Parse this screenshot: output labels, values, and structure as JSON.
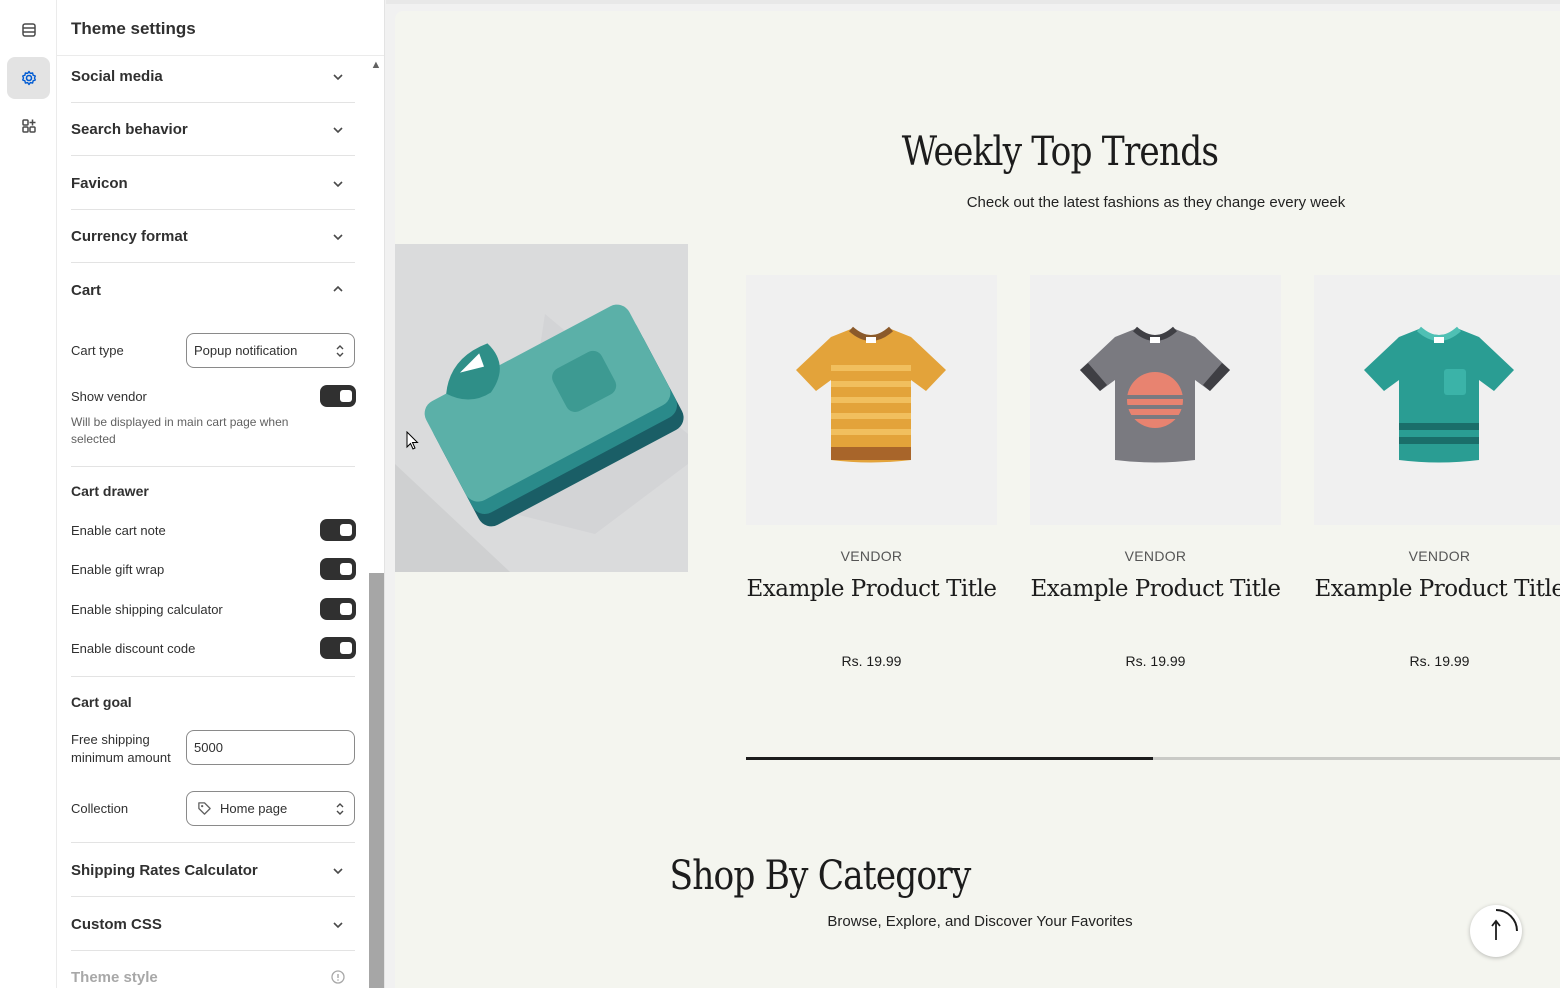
{
  "rail": {
    "items": [
      {
        "name": "sections-icon",
        "active": false
      },
      {
        "name": "settings-gear-icon",
        "active": true
      },
      {
        "name": "apps-icon",
        "active": false
      }
    ]
  },
  "panel": {
    "title": "Theme settings",
    "sections": {
      "social_media": "Social media",
      "search_behavior": "Search behavior",
      "favicon": "Favicon",
      "currency_format": "Currency format",
      "cart": "Cart",
      "shipping_rates": "Shipping Rates Calculator",
      "custom_css": "Custom CSS",
      "theme_style": "Theme style"
    },
    "cart": {
      "cart_type_label": "Cart type",
      "cart_type_value": "Popup notification",
      "show_vendor_label": "Show vendor",
      "show_vendor_on": true,
      "show_vendor_help": "Will be displayed in main cart page when selected",
      "drawer_heading": "Cart drawer",
      "enable_cart_note": "Enable cart note",
      "enable_gift_wrap": "Enable gift wrap",
      "enable_shipping_calculator": "Enable shipping calculator",
      "enable_discount_code": "Enable discount code",
      "goal_heading": "Cart goal",
      "free_shipping_label": "Free shipping minimum amount",
      "free_shipping_value": "5000",
      "collection_label": "Collection",
      "collection_value": "Home page"
    }
  },
  "preview": {
    "trends_title": "Weekly Top Trends",
    "trends_subtitle": "Check out the latest fashions as they change every week",
    "products": [
      {
        "vendor": "VENDOR",
        "title": "Example Product Title",
        "price": "Rs. 19.99",
        "color": "orange"
      },
      {
        "vendor": "VENDOR",
        "title": "Example Product Title",
        "price": "Rs. 19.99",
        "color": "grey"
      },
      {
        "vendor": "VENDOR",
        "title": "Example Product Title",
        "price": "Rs. 19.99",
        "color": "teal"
      }
    ],
    "carousel_progress": 0.5,
    "category_title": "Shop By Category",
    "category_subtitle": "Browse, Explore, and Discover Your Favorites"
  },
  "colors": {
    "accent_active": "#e3e3e3",
    "toggle_on": "#303030",
    "preview_bg": "#f4f5ef"
  }
}
